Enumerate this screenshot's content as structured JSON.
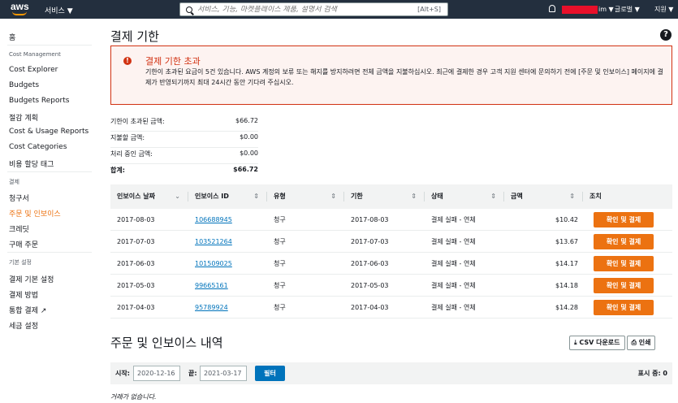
{
  "topnav": {
    "logo_text": "aws",
    "services_label": "서비스 ▼",
    "search_placeholder": "서비스, 기능, 마켓플레이스 제품, 설명서 검색",
    "search_shortcut": "[Alt+S]",
    "account_suffix": "im ▼",
    "region_label": "글로벌 ▼",
    "support_label": "지원 ▼"
  },
  "sidebar": {
    "home": "홈",
    "cost_head": "Cost Management",
    "cost_items": [
      "Cost Explorer",
      "Budgets",
      "Budgets Reports",
      "절감 계획",
      "Cost & Usage Reports",
      "Cost Categories",
      "비용 할당 태그"
    ],
    "billing_head": "결제",
    "billing_items": [
      "청구서",
      "주문 및 인보이스",
      "크레딧",
      "구매 주문"
    ],
    "pref_head": "기본 설정",
    "pref_items": [
      "결제 기본 설정",
      "결제 방법",
      "통합 결제 ↗",
      "세금 설정"
    ]
  },
  "main": {
    "title": "결제 기한",
    "alert": {
      "title": "결제 기한 초과",
      "message": "기한이 초과된 요금이 5건 있습니다. AWS 계정의 보류 또는 해지를 방지하려면 전체 금액을 지불하십시오. 최근에 결제한 경우 고객 지원 센터에 문의하기 전에 [주문 및 인보이스] 페이지에 결제가 반영되기까지 최대 24시간 동안 기다려 주십시오."
    },
    "summary": [
      {
        "label": "기한이 초과된 금액:",
        "value": "$66.72"
      },
      {
        "label": "지불할 금액:",
        "value": "$0.00"
      },
      {
        "label": "처리 중인 금액:",
        "value": "$0.00"
      },
      {
        "label": "합계:",
        "value": "$66.72"
      }
    ],
    "table": {
      "headers": [
        "인보이스 날짜",
        "인보이스 ID",
        "유형",
        "기한",
        "상태",
        "금액",
        "조치"
      ],
      "sort_first": "⌄",
      "sort_icon": "⇕",
      "pay_label": "확인 및 결제",
      "rows": [
        {
          "date": "2017-08-03",
          "id": "106688945",
          "type": "청구",
          "due": "2017-08-03",
          "status": "결제 실패 - 연체",
          "amount": "$10.42"
        },
        {
          "date": "2017-07-03",
          "id": "103521264",
          "type": "청구",
          "due": "2017-07-03",
          "status": "결제 실패 - 연체",
          "amount": "$13.67"
        },
        {
          "date": "2017-06-03",
          "id": "101509025",
          "type": "청구",
          "due": "2017-06-03",
          "status": "결제 실패 - 연체",
          "amount": "$14.17"
        },
        {
          "date": "2017-05-03",
          "id": "99665161",
          "type": "청구",
          "due": "2017-05-03",
          "status": "결제 실패 - 연체",
          "amount": "$14.18"
        },
        {
          "date": "2017-04-03",
          "id": "95789924",
          "type": "청구",
          "due": "2017-04-03",
          "status": "결제 실패 - 연체",
          "amount": "$14.28"
        }
      ]
    },
    "history": {
      "title": "주문 및 인보이스 내역",
      "csv_label": "⤓ CSV 다운로드",
      "print_label": "⎙ 인쇄",
      "start_label": "시작:",
      "start_value": "2020-12-16",
      "end_label": "끝:",
      "end_value": "2021-03-17",
      "filter_label": "필터",
      "count_label": "표시 중: 0",
      "empty_text": "거래가 없습니다."
    }
  }
}
